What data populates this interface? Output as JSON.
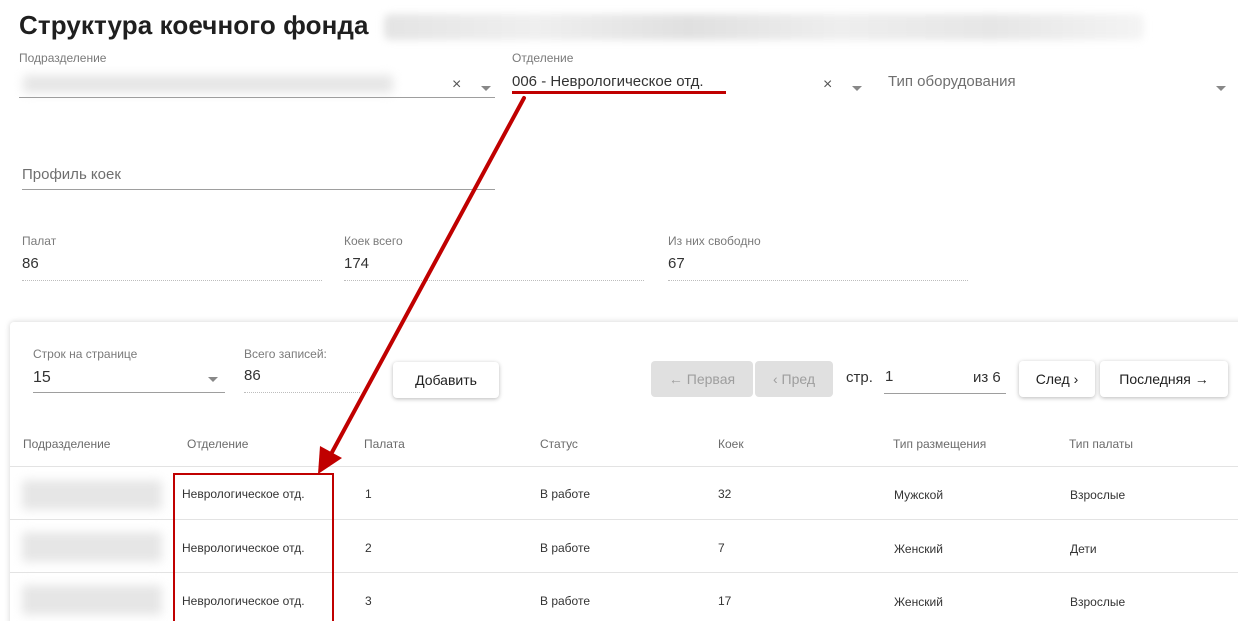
{
  "page": {
    "title": "Структура коечного фонда"
  },
  "filters": {
    "subdivision": {
      "label": "Подразделение",
      "value": "",
      "clear": "×"
    },
    "department": {
      "label": "Отделение",
      "value": "006 - Неврологическое отд.",
      "clear": "×"
    },
    "equipment_type": {
      "placeholder": "Тип оборудования"
    },
    "bed_profile": {
      "placeholder": "Профиль коек"
    }
  },
  "summary": {
    "rooms": {
      "label": "Палат",
      "value": "86"
    },
    "beds_total": {
      "label": "Коек всего",
      "value": "174"
    },
    "beds_free": {
      "label": "Из них свободно",
      "value": "67"
    }
  },
  "table_controls": {
    "rows_per_page": {
      "label": "Строк на странице",
      "value": "15"
    },
    "total_records": {
      "label": "Всего записей:",
      "value": "86"
    },
    "add_button": "Добавить",
    "first_button": "← Первая",
    "prev_button": "‹ Пред",
    "page_label": "стр.",
    "page_value": "1",
    "page_of": "из 6",
    "next_button": "След ›",
    "last_button": "Последняя →"
  },
  "table": {
    "columns": [
      "Подразделение",
      "Отделение",
      "Палата",
      "Статус",
      "Коек",
      "Тип размещения",
      "Тип палаты"
    ],
    "rows": [
      {
        "subdivision": "",
        "department": "Неврологическое отд.",
        "room": "1",
        "status": "В работе",
        "beds": "32",
        "placement": "Мужской",
        "room_type": "Взрослые"
      },
      {
        "subdivision": "",
        "department": "Неврологическое отд.",
        "room": "2",
        "status": "В работе",
        "beds": "7",
        "placement": "Женский",
        "room_type": "Дети"
      },
      {
        "subdivision": "",
        "department": "Неврологическое отд.",
        "room": "3",
        "status": "В работе",
        "beds": "17",
        "placement": "Женский",
        "room_type": "Взрослые"
      }
    ]
  },
  "colors": {
    "annotation_red": "#c00000",
    "disabled_button": "#e0e0e0"
  }
}
